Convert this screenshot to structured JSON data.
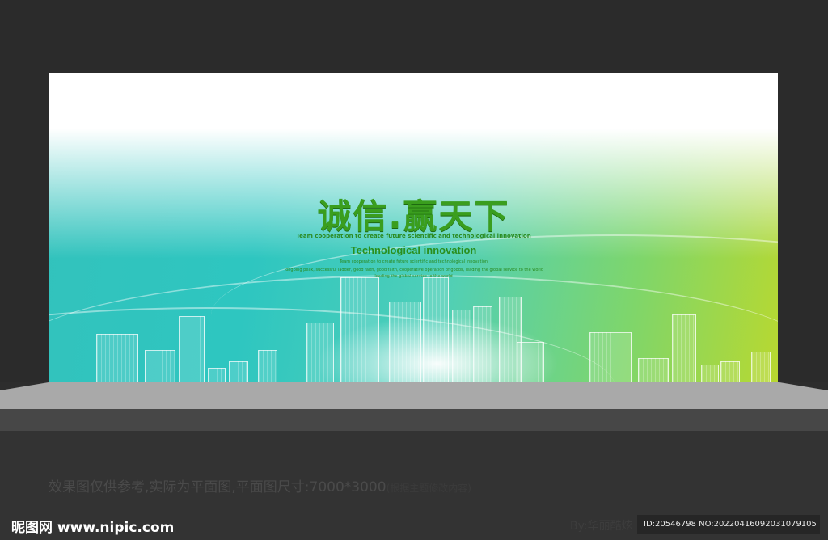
{
  "board": {
    "headline": "诚信.赢天下",
    "tagline_top": "Team cooperation to create future scientific and technological innovation",
    "subtitle": "Technological innovation",
    "line1": "Team cooperation to create future scientific and technological innovation",
    "line2": "Tongbing peak, successful ladder, good faith, good faith, cooperative operation of goods, leading the global service to the world",
    "line3": "leading the global service to the world"
  },
  "footer": {
    "note": "效果图仅供参考,实际为平面图,平面图尺寸:7000*3000",
    "note_faint": "(根据主题修改内容)",
    "logo": "昵图网 www.nipic.com",
    "by": "By:华丽酷炫",
    "id_line": "ID:20546798 NO:20220416092031079105"
  },
  "colors": {
    "headline": "#3a9e1e",
    "board_left": "#33c2bc",
    "board_right": "#b8d830",
    "background": "#2d2d2d"
  }
}
